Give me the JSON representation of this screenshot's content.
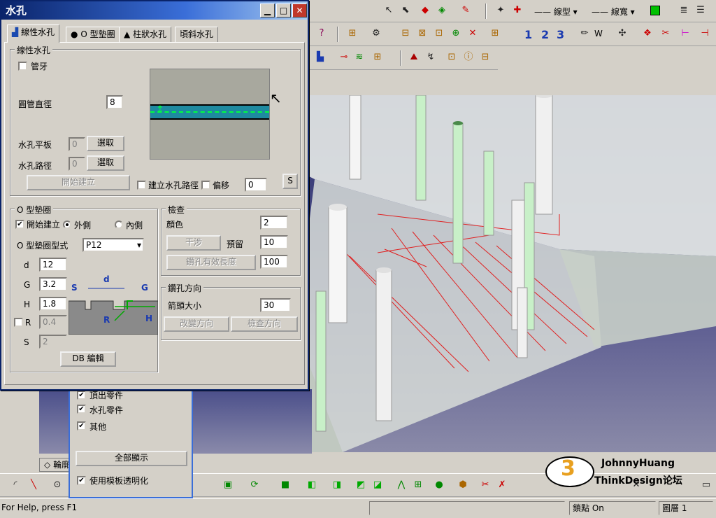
{
  "dialog": {
    "title": "水孔",
    "tabs": [
      {
        "label": "線性水孔",
        "icon": "linear-hole-icon"
      },
      {
        "label": "O 型墊圈",
        "icon": "oring-icon"
      },
      {
        "label": "柱狀水孔",
        "icon": "column-hole-icon"
      },
      {
        "label": "頃斜水孔",
        "icon": ""
      }
    ],
    "linear": {
      "group": "線性水孔",
      "pipe_thread": "管牙",
      "pipe_diameter_label": "圓管直徑",
      "pipe_diameter": "8",
      "plate_label": "水孔平板",
      "plate_value": "0",
      "path_label": "水孔路徑",
      "path_value": "0",
      "select1": "選取",
      "select2": "選取",
      "start_build": "開始建立",
      "build_path": "建立水孔路徑",
      "offset": "偏移",
      "offset_value": "0",
      "s_button": "S"
    },
    "oring": {
      "group": "O 型墊圈",
      "start_build": "開始建立",
      "outer": "外側",
      "inner": "內側",
      "type_label": "O 型墊圈型式",
      "type_value": "P12",
      "d_label": "d",
      "d_value": "12",
      "g_label": "G",
      "g_value": "3.2",
      "h_label": "H",
      "h_value": "1.8",
      "r_label": "R",
      "r_value": "0.4",
      "s_label": "S",
      "s_value": "2",
      "db_edit": "DB 編輯",
      "diagram_labels": {
        "s": "S",
        "d": "d",
        "g": "G",
        "r": "R",
        "h": "H"
      }
    },
    "check": {
      "group": "檢查",
      "color_label": "顏色",
      "color_value": "2",
      "interfere": "干涉",
      "reserve_label": "預留",
      "reserve_value": "10",
      "drill_len": "鑽孔有效長度",
      "drill_len_value": "100"
    },
    "drill_dir": {
      "group": "鑽孔方向",
      "arrow_label": "箭頭大小",
      "arrow_value": "30",
      "change_dir": "改變方向",
      "check_dir": "檢查方向"
    }
  },
  "panel": {
    "items": [
      {
        "label": "頂出零件",
        "checked": true
      },
      {
        "label": "水孔零件",
        "checked": true
      },
      {
        "label": "其他",
        "checked": true
      }
    ],
    "show_all": "全部顯示",
    "transparent": "使用模板透明化"
  },
  "toolbar": {
    "line_type": "線型",
    "line_width": "線寬",
    "nums": [
      "1",
      "2",
      "3"
    ],
    "w": "W"
  },
  "left_tab": "輪廓",
  "watermark": {
    "line1": "JohnnyHuang",
    "line2": "ThinkDesign论坛",
    "badge": "3"
  },
  "status": {
    "help": "For Help, press F1",
    "snap": "鎖點 On",
    "layer": "圖層 1"
  },
  "colors": {
    "title": "#0a246a",
    "green": "#00c000",
    "red": "#e02020"
  }
}
